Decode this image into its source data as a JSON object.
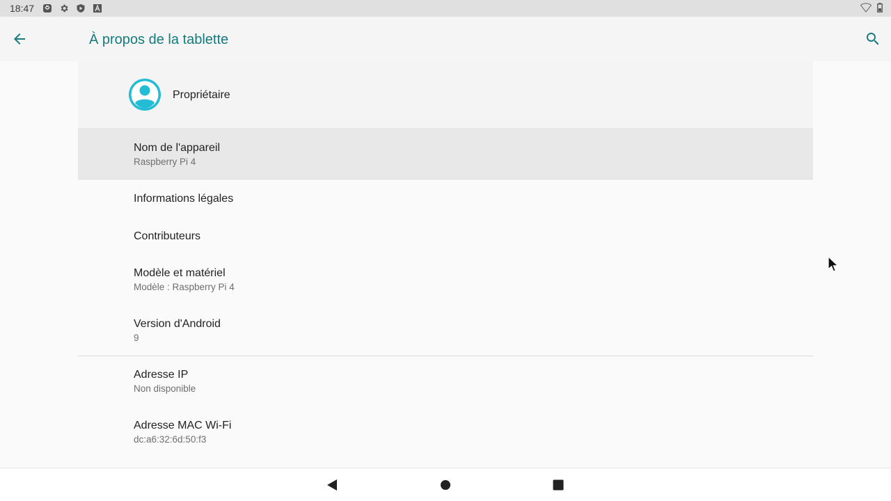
{
  "status_bar": {
    "time": "18:47",
    "left_icons": [
      "notification-app-icon",
      "settings-icon",
      "play-shield-icon",
      "keyboard-a-icon"
    ],
    "right_icons": [
      "wifi-icon",
      "battery-icon"
    ]
  },
  "app_bar": {
    "title": "À propos de la tablette",
    "back_icon": "arrow-back-icon",
    "search_icon": "search-icon",
    "accent": "#157a7d"
  },
  "owner": {
    "label": "Propriétaire",
    "avatar_color": "#22bcd4"
  },
  "preferences": [
    {
      "title": "Nom de l'appareil",
      "summary": "Raspberry Pi 4"
    },
    {
      "title": "Informations légales",
      "summary": ""
    },
    {
      "title": "Contributeurs",
      "summary": ""
    },
    {
      "title": "Modèle et matériel",
      "summary": "Modèle : Raspberry Pi 4"
    },
    {
      "title": "Version d'Android",
      "summary": "9"
    },
    {
      "title": "Adresse IP",
      "summary": "Non disponible"
    },
    {
      "title": "Adresse MAC Wi-Fi",
      "summary": "dc:a6:32:6d:50:f3"
    }
  ],
  "nav_bar": {
    "back": "nav-back-icon",
    "home": "nav-home-icon",
    "recents": "nav-recents-icon"
  }
}
